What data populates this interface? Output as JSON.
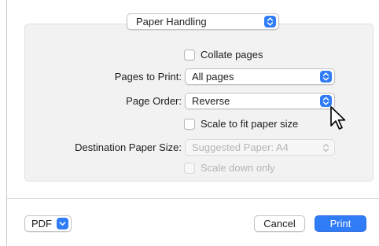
{
  "section_select": {
    "value": "Paper Handling"
  },
  "collate": {
    "label": "Collate pages",
    "checked": false
  },
  "pages_to_print": {
    "label": "Pages to Print:",
    "value": "All pages"
  },
  "page_order": {
    "label": "Page Order:",
    "value": "Reverse"
  },
  "scale_to_fit": {
    "label": "Scale to fit paper size",
    "checked": false
  },
  "destination_paper_size": {
    "label": "Destination Paper Size:",
    "value": "Suggested Paper: A4",
    "disabled": true
  },
  "scale_down_only": {
    "label": "Scale down only",
    "checked": false,
    "disabled": true
  },
  "footer": {
    "pdf_label": "PDF",
    "cancel_label": "Cancel",
    "print_label": "Print"
  },
  "colors": {
    "accent": "#2f7cf6",
    "panel": "#f2f2f2"
  },
  "icons": {
    "stepper": "up-down-chevron-icon",
    "cursor": "mouse-pointer-icon"
  }
}
